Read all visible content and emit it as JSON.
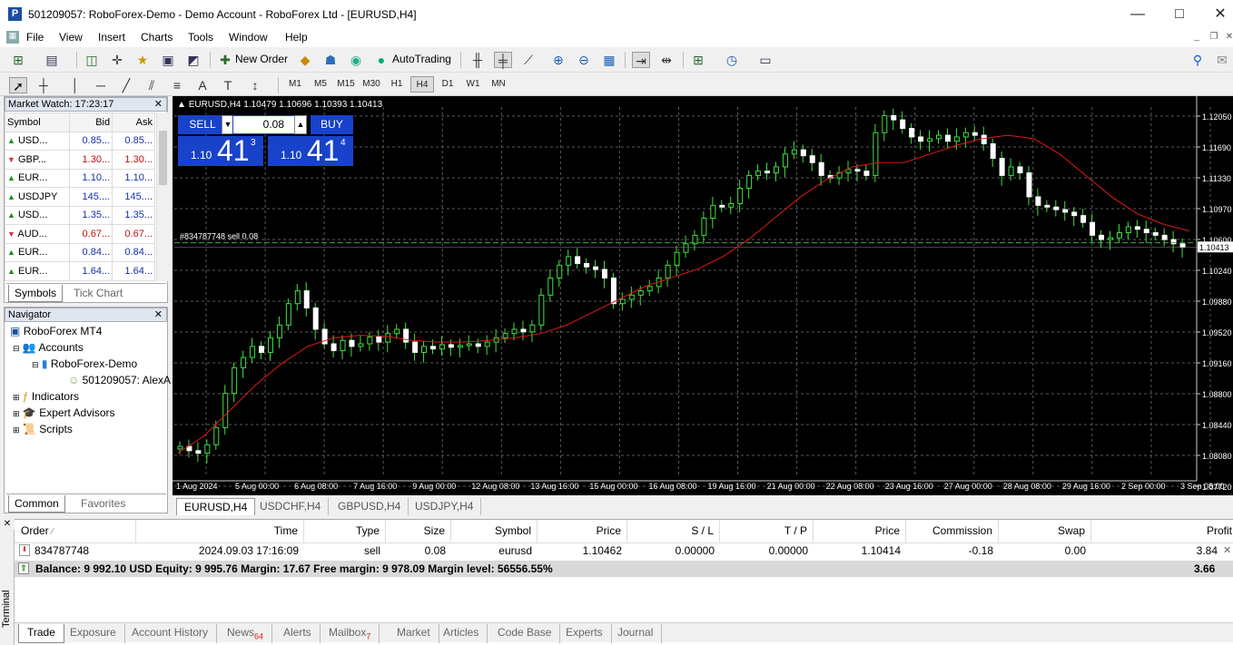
{
  "window": {
    "title": "501209057: RoboForex-Demo - Demo Account - RoboForex Ltd - [EURUSD,H4]",
    "logo": "P"
  },
  "menu": [
    "File",
    "View",
    "Insert",
    "Charts",
    "Tools",
    "Window",
    "Help"
  ],
  "toolbar": {
    "new_order": "New Order",
    "autotrading": "AutoTrading"
  },
  "timeframes": [
    "M1",
    "M5",
    "M15",
    "M30",
    "H1",
    "H4",
    "D1",
    "W1",
    "MN"
  ],
  "active_timeframe": "H4",
  "market_watch": {
    "title": "Market Watch: 17:23:17",
    "headers": [
      "Symbol",
      "Bid",
      "Ask"
    ],
    "rows": [
      {
        "dir": "up",
        "symbol": "USD...",
        "bid": "0.85...",
        "ask": "0.85...",
        "color": "blue"
      },
      {
        "dir": "dn",
        "symbol": "GBP...",
        "bid": "1.30...",
        "ask": "1.30...",
        "color": "red"
      },
      {
        "dir": "up",
        "symbol": "EUR...",
        "bid": "1.10...",
        "ask": "1.10...",
        "color": "blue"
      },
      {
        "dir": "up",
        "symbol": "USDJPY",
        "bid": "145....",
        "ask": "145....",
        "color": "blue"
      },
      {
        "dir": "up",
        "symbol": "USD...",
        "bid": "1.35...",
        "ask": "1.35...",
        "color": "blue"
      },
      {
        "dir": "dn",
        "symbol": "AUD...",
        "bid": "0.67...",
        "ask": "0.67...",
        "color": "red"
      },
      {
        "dir": "up",
        "symbol": "EUR...",
        "bid": "0.84...",
        "ask": "0.84...",
        "color": "blue"
      },
      {
        "dir": "up",
        "symbol": "EUR...",
        "bid": "1.64...",
        "ask": "1.64...",
        "color": "blue"
      }
    ],
    "tabs": [
      "Symbols",
      "Tick Chart"
    ]
  },
  "navigator": {
    "title": "Navigator",
    "root": "RoboForex MT4",
    "accounts": "Accounts",
    "server": "RoboForex-Demo",
    "account": "501209057: AlexA",
    "indicators": "Indicators",
    "experts": "Expert Advisors",
    "scripts": "Scripts",
    "tabs": [
      "Common",
      "Favorites"
    ]
  },
  "chart": {
    "header": "EURUSD,H4  1.10479 1.10696 1.10393 1.10413",
    "one_click": {
      "sell": "SELL",
      "buy": "BUY",
      "volume": "0.08",
      "sell_small": "1.10",
      "sell_big": "41",
      "sell_sup": "3",
      "buy_small": "1.10",
      "buy_big": "41",
      "buy_sup": "4"
    },
    "order_line_label": "#834787748 sell 0.08",
    "current_price": "1.10413",
    "price_labels": [
      "1.12050",
      "1.11690",
      "1.11330",
      "1.10970",
      "1.10600",
      "1.10240",
      "1.09880",
      "1.09520",
      "1.09160",
      "1.08800",
      "1.08440",
      "1.08080",
      "1.07720"
    ],
    "time_labels": [
      "1 Aug 2024",
      "5 Aug 00:00",
      "6 Aug 08:00",
      "7 Aug 16:00",
      "9 Aug 00:00",
      "12 Aug 08:00",
      "13 Aug 16:00",
      "15 Aug 00:00",
      "16 Aug 08:00",
      "19 Aug 16:00",
      "21 Aug 00:00",
      "22 Aug 08:00",
      "23 Aug 16:00",
      "27 Aug 00:00",
      "28 Aug 08:00",
      "29 Aug 16:00",
      "2 Sep 00:00",
      "3 Sep 08:00"
    ],
    "tabs": [
      "EURUSD,H4",
      "USDCHF,H4",
      "GBPUSD,H4",
      "USDJPY,H4"
    ]
  },
  "chart_data": {
    "type": "candlestick",
    "symbol": "EURUSD",
    "timeframe": "H4",
    "ylim": [
      1.0772,
      1.1205
    ],
    "open": 1.10479,
    "high": 1.10696,
    "low": 1.10393,
    "close": 1.10413,
    "closes": [
      1.0808,
      1.0803,
      1.08,
      1.081,
      1.083,
      1.087,
      1.09,
      1.0912,
      1.0925,
      1.0918,
      1.0935,
      1.095,
      1.0975,
      1.099,
      1.097,
      1.0945,
      1.0928,
      1.092,
      1.0932,
      1.0925,
      1.0928,
      1.0936,
      1.093,
      1.094,
      1.0945,
      1.093,
      1.0918,
      1.0925,
      1.0922,
      1.0927,
      1.0924,
      1.0926,
      1.0928,
      1.0925,
      1.093,
      1.0935,
      1.094,
      1.0945,
      1.0942,
      1.095,
      1.0985,
      1.1005,
      1.102,
      1.103,
      1.1022,
      1.1018,
      1.1015,
      1.1005,
      1.0975,
      1.098,
      1.0985,
      1.099,
      1.0995,
      1.1005,
      1.102,
      1.1035,
      1.1045,
      1.1055,
      1.1075,
      1.109,
      1.1088,
      1.1092,
      1.111,
      1.1125,
      1.113,
      1.1128,
      1.1135,
      1.115,
      1.1155,
      1.1148,
      1.114,
      1.1125,
      1.1122,
      1.1128,
      1.1132,
      1.113,
      1.1125,
      1.1175,
      1.1195,
      1.119,
      1.118,
      1.117,
      1.1165,
      1.1168,
      1.1172,
      1.1165,
      1.117,
      1.1175,
      1.1172,
      1.1162,
      1.1145,
      1.1125,
      1.1135,
      1.1128,
      1.11,
      1.109,
      1.1088,
      1.1085,
      1.1082,
      1.1078,
      1.107,
      1.1055,
      1.105,
      1.1052,
      1.1058,
      1.1065,
      1.1062,
      1.1058,
      1.1055,
      1.105,
      1.1045,
      1.1041
    ],
    "ma": [
      1.08,
      1.082,
      1.085,
      1.088,
      1.0905,
      1.0925,
      1.0935,
      1.0938,
      1.0937,
      1.0932,
      1.093,
      1.093,
      1.0932,
      1.0935,
      1.094,
      1.095,
      1.0965,
      1.098,
      1.0995,
      1.1005,
      1.1015,
      1.103,
      1.105,
      1.1075,
      1.11,
      1.112,
      1.1135,
      1.114,
      1.114,
      1.115,
      1.116,
      1.1168,
      1.1172,
      1.1168,
      1.115,
      1.1125,
      1.11,
      1.108,
      1.1068,
      1.106
    ],
    "order_price": 1.10462
  },
  "terminal": {
    "side_label": "Terminal",
    "columns": [
      "Order",
      "Time",
      "Type",
      "Size",
      "Symbol",
      "Price",
      "S / L",
      "T / P",
      "Price",
      "Commission",
      "Swap",
      "Profit"
    ],
    "row": {
      "order": "834787748",
      "time": "2024.09.03 17:16:09",
      "type": "sell",
      "size": "0.08",
      "symbol": "eurusd",
      "price": "1.10462",
      "sl": "0.00000",
      "tp": "0.00000",
      "price2": "1.10414",
      "commission": "-0.18",
      "swap": "0.00",
      "profit": "3.84"
    },
    "balance_text": "Balance: 9 992.10 USD  Equity: 9 995.76  Margin: 17.67  Free margin: 9 978.09  Margin level: 56556.55%",
    "balance_profit": "3.66",
    "tabs": [
      {
        "label": "Trade",
        "badge": ""
      },
      {
        "label": "Exposure",
        "badge": ""
      },
      {
        "label": "Account History",
        "badge": ""
      },
      {
        "label": "News",
        "badge": "64"
      },
      {
        "label": "Alerts",
        "badge": ""
      },
      {
        "label": "Mailbox",
        "badge": "7"
      },
      {
        "label": "Market",
        "badge": ""
      },
      {
        "label": "Articles",
        "badge": ""
      },
      {
        "label": "Code Base",
        "badge": ""
      },
      {
        "label": "Experts",
        "badge": ""
      },
      {
        "label": "Journal",
        "badge": ""
      }
    ]
  }
}
